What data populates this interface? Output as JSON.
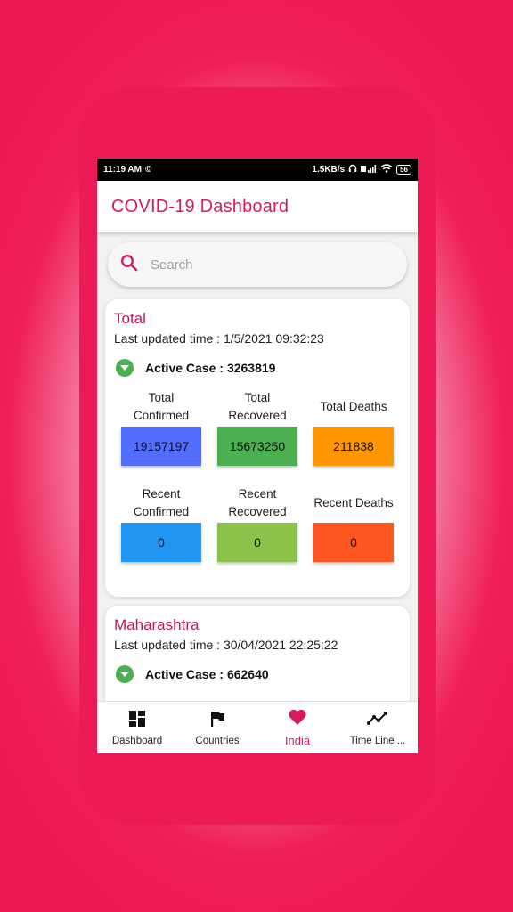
{
  "status_bar": {
    "time": "11:19 AM",
    "speed": "1.5KB/s",
    "battery": "56"
  },
  "app": {
    "title": "COVID-19 Dashboard"
  },
  "search": {
    "placeholder": "Search"
  },
  "cards": [
    {
      "title": "Total",
      "updated": "Last updated time : 1/5/2021 09:32:23",
      "active_label": "Active Case :",
      "active_value": "3263819",
      "stats": [
        {
          "label": "Total Confirmed",
          "value": "19157197",
          "color": "#536dfe"
        },
        {
          "label": "Total Recovered",
          "value": "15673250",
          "color": "#4caf50"
        },
        {
          "label": "Total Deaths",
          "value": "211838",
          "color": "#ff9800"
        },
        {
          "label": "Recent Confirmed",
          "value": "0",
          "color": "#2196f3"
        },
        {
          "label": "Recent Recovered",
          "value": "0",
          "color": "#8bc34a"
        },
        {
          "label": "Recent Deaths",
          "value": "0",
          "color": "#ff5722"
        }
      ]
    },
    {
      "title": "Maharashtra",
      "updated": "Last updated time : 30/04/2021 22:25:22",
      "active_label": "Active Case :",
      "active_value": "662640"
    }
  ],
  "nav": [
    {
      "label": "Dashboard",
      "icon": "dashboard-icon"
    },
    {
      "label": "Countries",
      "icon": "flag-icon"
    },
    {
      "label": "India",
      "icon": "heart-icon",
      "active": true
    },
    {
      "label": "Time Line ...",
      "icon": "timeline-icon"
    }
  ],
  "colors": {
    "brand": "#d81b60",
    "frame": "#ec1b55",
    "active_chevron": "#4caf50"
  }
}
